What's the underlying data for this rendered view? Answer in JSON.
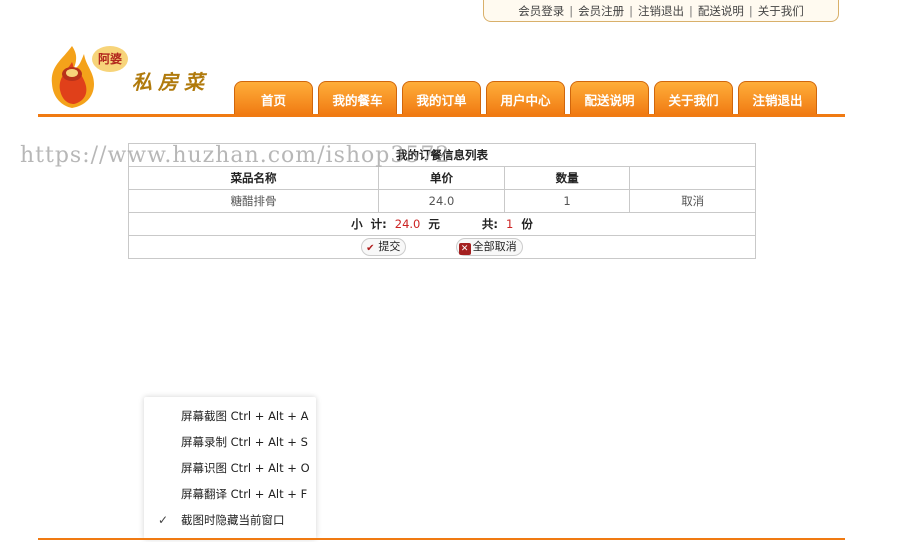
{
  "top_links": [
    "会员登录",
    "会员注册",
    "注销退出",
    "配送说明",
    "关于我们"
  ],
  "top_separator": "|",
  "logo": {
    "badge": "阿婆",
    "script": "私房菜"
  },
  "nav": [
    "首页",
    "我的餐车",
    "我的订单",
    "用户中心",
    "配送说明",
    "关于我们",
    "注销退出"
  ],
  "watermark": "https://www.huzhan.com/ishop3572",
  "order": {
    "caption": "我的订餐信息列表",
    "headers": [
      "菜品名称",
      "单价",
      "数量",
      ""
    ],
    "rows": [
      {
        "name": "糖醋排骨",
        "price": "24.0",
        "qty": "1",
        "action": "取消"
      }
    ],
    "subtotal_label": "小  计:",
    "subtotal_value": "24.0",
    "subtotal_unit": "元",
    "total_label": "共:",
    "total_value": "1",
    "total_unit": "份",
    "submit_label": "提交",
    "cancel_all_label": "全部取消"
  },
  "context_menu": [
    {
      "label": "屏幕截图 Ctrl + Alt + A",
      "checked": false
    },
    {
      "label": "屏幕录制 Ctrl + Alt + S",
      "checked": false
    },
    {
      "label": "屏幕识图 Ctrl + Alt + O",
      "checked": false
    },
    {
      "label": "屏幕翻译 Ctrl + Alt + F",
      "checked": false
    },
    {
      "label": "截图时隐藏当前窗口",
      "checked": true
    }
  ],
  "colors": {
    "accent": "#f07a12",
    "price": "#cc2222"
  }
}
